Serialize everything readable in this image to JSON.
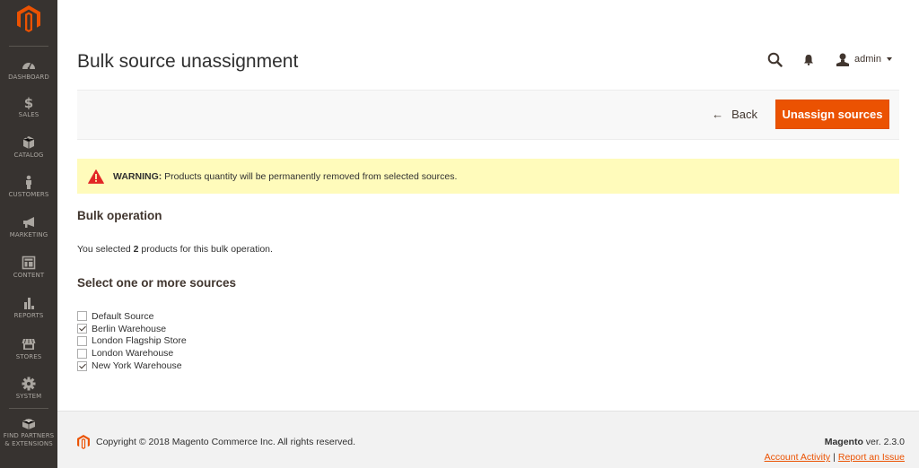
{
  "sidebar": {
    "logo": "magento-logo",
    "items": [
      {
        "label": "DASHBOARD",
        "icon": "dashboard-icon"
      },
      {
        "label": "SALES",
        "icon": "dollar-icon"
      },
      {
        "label": "CATALOG",
        "icon": "box-icon"
      },
      {
        "label": "CUSTOMERS",
        "icon": "person-icon"
      },
      {
        "label": "MARKETING",
        "icon": "megaphone-icon"
      },
      {
        "label": "CONTENT",
        "icon": "layout-icon"
      },
      {
        "label": "REPORTS",
        "icon": "bar-chart-icon"
      },
      {
        "label": "STORES",
        "icon": "storefront-icon"
      },
      {
        "label": "SYSTEM",
        "icon": "gear-icon"
      },
      {
        "label_line1": "FIND PARTNERS",
        "label_line2": "& EXTENSIONS",
        "icon": "lego-brick-icon"
      }
    ]
  },
  "header": {
    "title": "Bulk source unassignment",
    "user": "admin",
    "icons": [
      "search-icon",
      "bell-icon",
      "user-icon"
    ]
  },
  "action_bar": {
    "back_label": "Back",
    "primary_label": "Unassign sources"
  },
  "warning": {
    "prefix": "WARNING:",
    "message": " Products quantity will be permanently removed from selected sources."
  },
  "bulk": {
    "title": "Bulk operation",
    "text_before": "You selected ",
    "count": "2",
    "text_after": " products for this bulk operation."
  },
  "sources": {
    "title": "Select one or more sources",
    "items": [
      {
        "label": "Default Source",
        "checked": false
      },
      {
        "label": "Berlin Warehouse",
        "checked": true
      },
      {
        "label": "London Flagship Store",
        "checked": false
      },
      {
        "label": "London Warehouse",
        "checked": false
      },
      {
        "label": "New York Warehouse",
        "checked": true
      }
    ]
  },
  "footer": {
    "copyright": "Copyright © 2018 Magento Commerce Inc. All rights reserved.",
    "brand": "Magento",
    "version": " ver. 2.3.0",
    "link_activity": "Account Activity",
    "separator": "|",
    "link_issue": "Report an Issue"
  },
  "colors": {
    "accent": "#eb5202",
    "sidebar_bg": "#373330",
    "warning_bg": "#fffbbb"
  }
}
